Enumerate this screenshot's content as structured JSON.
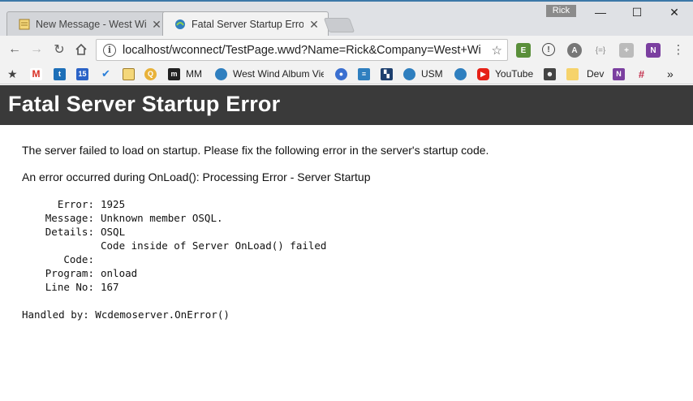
{
  "browser": {
    "tabs": [
      {
        "title": "New Message - West Wi",
        "active": false
      },
      {
        "title": "Fatal Server Startup Error",
        "active": true
      }
    ],
    "profile_name": "Rick",
    "address": "localhost/wconnect/TestPage.wwd?Name=Rick&Company=West+Wind",
    "window_controls": {
      "minimize": "—",
      "maximize": "☐",
      "close": "✕"
    },
    "bookmarks": [
      {
        "label": "",
        "icon": "gmail-icon"
      },
      {
        "label": "",
        "icon": "twitter-icon"
      },
      {
        "label": "",
        "icon": "calendar-icon"
      },
      {
        "label": "",
        "icon": "check-icon"
      },
      {
        "label": "",
        "icon": "note-icon"
      },
      {
        "label": "",
        "icon": "search-icon"
      },
      {
        "label": "MM",
        "icon": "mm-icon"
      },
      {
        "label": "West Wind Album Vie",
        "icon": "westwind-icon"
      },
      {
        "label": "",
        "icon": "user-icon"
      },
      {
        "label": "",
        "icon": "list-icon"
      },
      {
        "label": "",
        "icon": "image-icon"
      },
      {
        "label": "USM",
        "icon": "westwind-icon"
      },
      {
        "label": "",
        "icon": "westwind-icon"
      },
      {
        "label": "YouTube",
        "icon": "youtube-icon"
      },
      {
        "label": "",
        "icon": "portrait-icon"
      },
      {
        "label": "",
        "icon": "folder-icon"
      },
      {
        "label": "Dev",
        "icon": "folder-icon"
      },
      {
        "label": "",
        "icon": "onenote-icon"
      },
      {
        "label": "",
        "icon": "slack-icon"
      }
    ],
    "more_bookmarks": "»"
  },
  "colors": {
    "header_bg": "#3a3a3a",
    "header_text": "#ffffff",
    "chrome_bg": "#f2f2f2"
  },
  "page": {
    "title": "Fatal Server Startup Error",
    "intro": "The server failed to load on startup. Please fix the following error in the server's startup code.",
    "error_summary": "An error occurred during OnLoad(): Processing Error - Server Startup",
    "details": [
      {
        "key": "Error:",
        "value": "1925"
      },
      {
        "key": "Message:",
        "value": "Unknown member OSQL."
      },
      {
        "key": "Details:",
        "value": "OSQL"
      },
      {
        "key": "",
        "value": "Code inside of Server OnLoad() failed"
      },
      {
        "key": "Code:",
        "value": ""
      },
      {
        "key": "Program:",
        "value": "onload"
      },
      {
        "key": "Line No:",
        "value": "167"
      }
    ],
    "handled_by": "Handled by: Wcdemoserver.OnError()"
  }
}
